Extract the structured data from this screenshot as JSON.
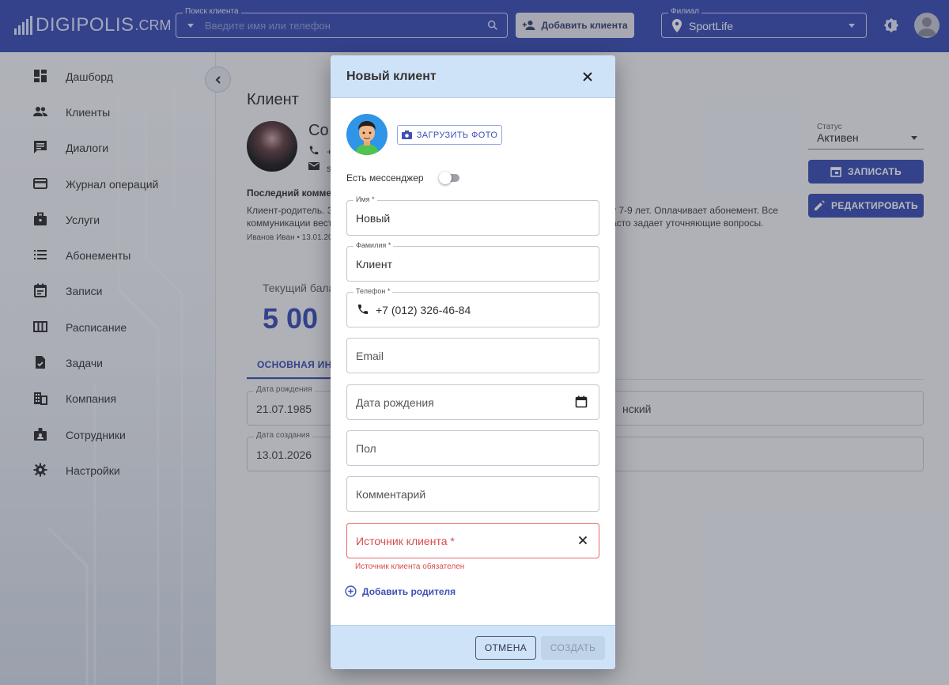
{
  "app": {
    "logo": "DIGIPOLIS",
    "logo_suffix": ".CRM"
  },
  "topbar": {
    "search_label": "Поиск клиента",
    "search_placeholder": "Введите имя или телефон",
    "add_client_label": "Добавить клиента",
    "branch_label": "Филиал",
    "branch_value": "SportLife"
  },
  "sidebar": {
    "items": [
      {
        "label": "Дашборд",
        "icon": "dashboard-icon"
      },
      {
        "label": "Клиенты",
        "icon": "people-icon"
      },
      {
        "label": "Диалоги",
        "icon": "chat-icon"
      },
      {
        "label": "Журнал операций",
        "icon": "card-icon"
      },
      {
        "label": "Услуги",
        "icon": "briefcase-icon"
      },
      {
        "label": "Абонементы",
        "icon": "list-icon"
      },
      {
        "label": "Записи",
        "icon": "calendar-icon"
      },
      {
        "label": "Расписание",
        "icon": "schedule-icon"
      },
      {
        "label": "Задачи",
        "icon": "task-icon"
      },
      {
        "label": "Компания",
        "icon": "building-icon"
      },
      {
        "label": "Сотрудники",
        "icon": "badge-icon"
      },
      {
        "label": "Настройки",
        "icon": "gear-icon"
      }
    ]
  },
  "client_page": {
    "title": "Клиент",
    "name_fragment": "Со",
    "phone_fragment": "+",
    "email_fragment": "s",
    "last_comment_title": "Последний коммен",
    "comment_line1_left": "Клиент-родитель. З",
    "comment_line1_right": "у 7-9 лет. Оплачивает абонемент. Все",
    "comment_line2_left": "коммуникации вест",
    "comment_line2_right": "асто задает уточняющие вопросы.",
    "comment_author": "Иванов Иван • 13.01.20",
    "balance_label": "Текущий бала",
    "balance_value": "5 00",
    "tab_main": "ОСНОВНАЯ ИНФ",
    "birth_label": "Дата рождения",
    "birth_value": "21.07.1985",
    "created_label": "Дата создания",
    "created_value": "13.01.2026",
    "right_field_value": "нский",
    "status_label": "Статус",
    "status_value": "Активен",
    "book_label": "ЗАПИСАТЬ",
    "edit_label": "РЕДАКТИРОВАТЬ"
  },
  "modal": {
    "title": "Новый клиент",
    "upload_label": "ЗАГРУЗИТЬ ФОТО",
    "messenger_label": "Есть мессенджер",
    "messenger_enabled": false,
    "first_name_label": "Имя *",
    "first_name_value": "Новый",
    "last_name_label": "Фамилия *",
    "last_name_value": "Клиент",
    "phone_label": "Телефон *",
    "phone_value": "+7 (012) 326-46-84",
    "email_placeholder": "Email",
    "birthdate_placeholder": "Дата рождения",
    "gender_placeholder": "Пол",
    "comment_placeholder": "Комментарий",
    "source_placeholder": "Источник клиента *",
    "source_error": "Источник клиента обязателен",
    "add_parent_label": "Добавить родителя",
    "cancel_label": "ОТМЕНА",
    "create_label": "СОЗДАТЬ"
  },
  "colors": {
    "primary": "#3f51b5",
    "modal_header": "#cfe3f8",
    "error": "#d84b4b"
  }
}
